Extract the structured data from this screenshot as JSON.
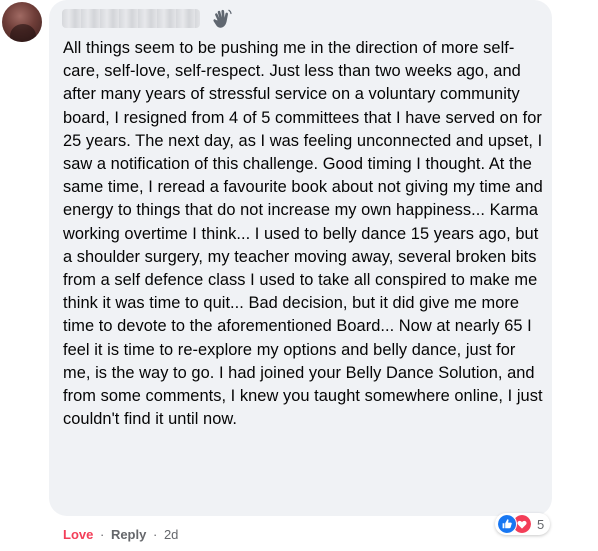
{
  "comment": {
    "author_name": "",
    "author_badge_icon": "waving-hand-icon",
    "text": "All things seem to be pushing me in the direction of more self-care, self-love, self-respect. Just less than two weeks ago, and after many years of stressful service on a voluntary community board, I resigned from 4 of 5 committees that I have served on for 25 years. The next day, as I was feeling unconnected and upset, I saw a notification of this challenge. Good timing I thought. At the same time, I reread a favourite book about not giving my time and energy to things that do not increase my own happiness... Karma working overtime I think... I used to belly dance 15 years ago, but a shoulder surgery, my teacher moving away, several broken bits from a self defence class I used to take all conspired to make me think it was time to quit... Bad decision, but it did give me more time to devote to the aforementioned Board... Now at nearly 65 I feel it is time to re-explore my options and belly dance, just for me, is the way to go. I had joined your Belly Dance Solution, and from some comments, I knew you taught somewhere online, I just couldn't find it until now.",
    "actions": {
      "love_label": "Love",
      "separator": "·",
      "reply_label": "Reply",
      "timestamp": "2d"
    },
    "reactions": {
      "icons": [
        "like-icon",
        "love-icon"
      ],
      "count": "5"
    }
  },
  "colors": {
    "bubble_background": "#f0f2f5",
    "love_red": "#f33e58",
    "like_blue": "#1877f2",
    "secondary_text": "#65676b",
    "primary_text": "#050505"
  }
}
